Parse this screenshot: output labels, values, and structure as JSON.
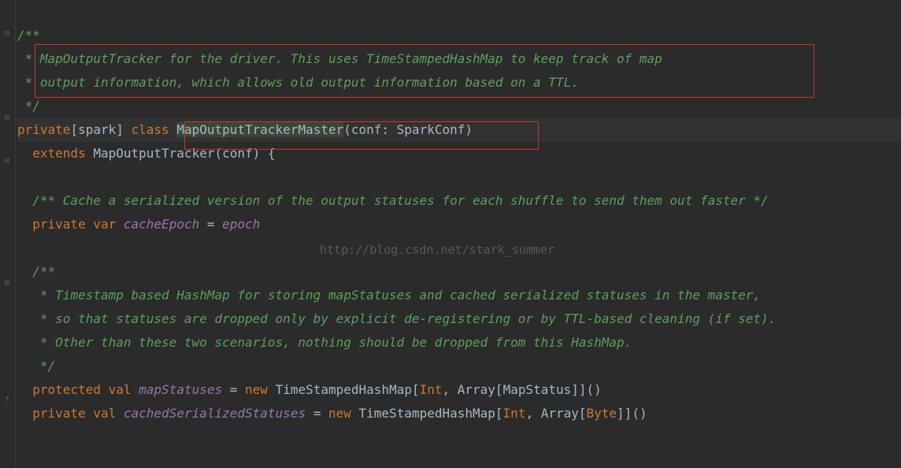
{
  "code": {
    "l1": "/**",
    "l2": " * MapOutputTracker for the driver. This uses TimeStampedHashMap to keep track of map",
    "l3": " * output information, which allows old output information based on a TTL.",
    "l4": " */",
    "l5_private": "private",
    "l5_spark": "[spark] ",
    "l5_class": "class",
    "l5_name": "MapOutputTrackerMaster",
    "l5_params": "(conf: SparkConf)",
    "l6_extends": "extends",
    "l6_rest": " MapOutputTracker(conf) {",
    "l8_comment": "/** Cache a serialized version of the output statuses for each shuffle to send them out faster */",
    "l9_private": "private",
    "l9_var": "var",
    "l9_name": "cacheEpoch",
    "l9_eq": " = ",
    "l9_val": "epoch",
    "l11": "/**",
    "l12": " * Timestamp based HashMap for storing mapStatuses and cached serialized statuses in the master,",
    "l13": " * so that statuses are dropped only by explicit de-registering or by TTL-based cleaning (if set).",
    "l14": " * Other than these two scenarios, nothing should be dropped from this HashMap.",
    "l15": " */",
    "l16_protected": "protected",
    "l16_val": "val",
    "l16_name": "mapStatuses",
    "l16_eq": " = ",
    "l16_new": "new",
    "l16_type": " TimeStampedHashMap[",
    "l16_int": "Int",
    "l16_mid": ", Array[MapStatus]]()",
    "l17_private": "private",
    "l17_val": "val",
    "l17_name": "cachedSerializedStatuses",
    "l17_eq": " = ",
    "l17_new": "new",
    "l17_type": " TimeStampedHashMap[",
    "l17_int": "Int",
    "l17_mid": ", Array[",
    "l17_byte": "Byte",
    "l17_end": "]]()"
  },
  "watermark": "http://blog.csdn.net/stark_summer"
}
